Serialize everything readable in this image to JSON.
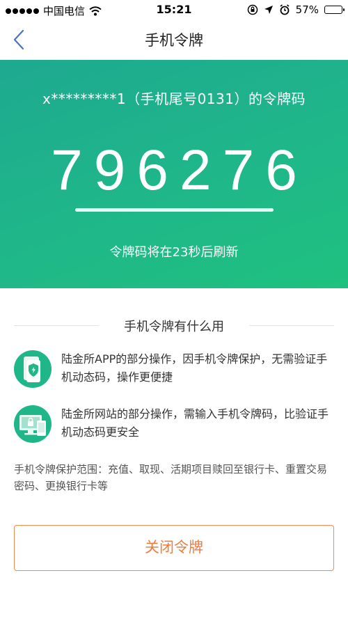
{
  "status_bar": {
    "carrier": "中国电信",
    "time": "15:21",
    "battery": "57%",
    "battery_level": 0.57,
    "icons": [
      "signal-dots-icon",
      "wifi-icon",
      "orientation-lock-icon",
      "location-arrow-icon",
      "alarm-icon",
      "battery-icon"
    ]
  },
  "nav": {
    "title": "手机令牌",
    "back_icon": "chevron-left-icon"
  },
  "token": {
    "subtitle": "x*********1（手机尾号0131）的令牌码",
    "code": "796276",
    "refresh_text": "令牌码将在23秒后刷新",
    "progress": 1.0
  },
  "info": {
    "title": "手机令牌有什么用",
    "features": [
      {
        "icon": "phone-shield-icon",
        "text": "陆金所APP的部分操作，因手机令牌保护，无需验证手机动态码，操作更便捷"
      },
      {
        "icon": "monitor-lock-icon",
        "text": "陆金所网站的部分操作，需输入手机令牌码，比验证手机动态码更安全"
      }
    ],
    "scope": "手机令牌保护范围：充值、取现、活期项目赎回至银行卡、重置交易密码、更换银行卡等"
  },
  "actions": {
    "close_label": "关闭令牌"
  },
  "colors": {
    "brand_green": "#1fb789",
    "accent_orange": "#ef7b3c",
    "back_blue": "#4a72c8"
  }
}
